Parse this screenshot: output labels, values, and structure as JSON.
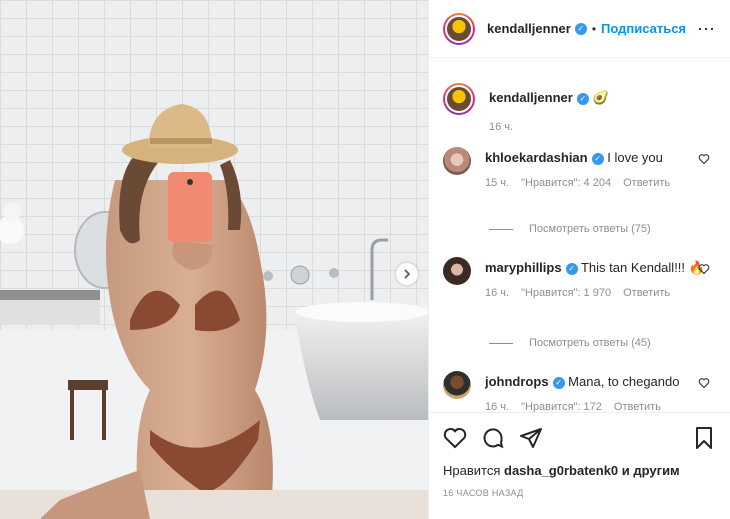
{
  "header": {
    "username": "kendalljenner",
    "verified": true,
    "separator": "•",
    "follow_label": "Подписаться",
    "more_icon": "more-horizontal-icon"
  },
  "caption": {
    "username": "kendalljenner",
    "text": "🥑",
    "time": "16 ч."
  },
  "comments": [
    {
      "username": "khloekardashian",
      "text": "I love you",
      "time": "15 ч.",
      "likes": "\"Нравится\": 4 204",
      "reply": "Ответить",
      "view_replies": "Посмотреть ответы (75)"
    },
    {
      "username": "maryphillips",
      "text": "This tan Kendall!!! 🔥",
      "time": "16 ч.",
      "likes": "\"Нравится\": 1 970",
      "reply": "Ответить",
      "view_replies": "Посмотреть ответы (45)"
    },
    {
      "username": "johndrops",
      "text": "Mana, to chegando",
      "time": "16 ч.",
      "likes": "\"Нравится\": 172",
      "reply": "Ответить"
    }
  ],
  "footer": {
    "likes_prefix": "Нравится",
    "likes_user": "dasha_g0rbatenk0",
    "likes_suffix": "и другим",
    "timestamp": "16 часов назад"
  },
  "colors": {
    "accent": "#0095f6",
    "verified": "#3897f0",
    "muted": "#8e8e8e"
  }
}
